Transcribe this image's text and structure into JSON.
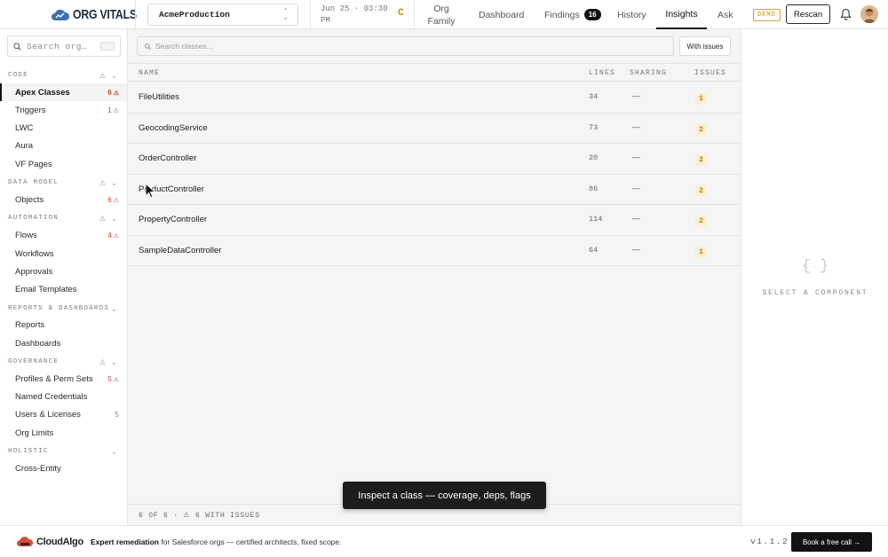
{
  "header": {
    "logo_text": "ORG VITALS",
    "org_name": "AcmeProduction",
    "scan_date_line1": "Jun 25 · 03:30",
    "scan_date_line2": "PM",
    "grade": "C",
    "nav": [
      {
        "label_line1": "Org",
        "label_line2": "Family"
      },
      {
        "label": "Dashboard"
      },
      {
        "label": "Findings",
        "badge": "16"
      },
      {
        "label": "History"
      },
      {
        "label": "Insights",
        "active": true
      },
      {
        "label": "Ask"
      }
    ],
    "demo_badge": "DEMO",
    "rescan_label": "Rescan"
  },
  "sidebar": {
    "search_placeholder": "Search org…",
    "sections": [
      {
        "title": "CODE",
        "items": [
          {
            "label": "Apex Classes",
            "count": "6",
            "warn": true,
            "active": true
          },
          {
            "label": "Triggers",
            "count": "1",
            "warn": true
          },
          {
            "label": "LWC"
          },
          {
            "label": "Aura"
          },
          {
            "label": "VF Pages"
          }
        ]
      },
      {
        "title": "DATA MODEL",
        "items": [
          {
            "label": "Objects",
            "count": "6",
            "warn": true
          }
        ]
      },
      {
        "title": "AUTOMATION",
        "items": [
          {
            "label": "Flows",
            "count": "4",
            "warn": true
          },
          {
            "label": "Workflows"
          },
          {
            "label": "Approvals"
          },
          {
            "label": "Email Templates"
          }
        ]
      },
      {
        "title": "REPORTS & DASHBOARDS",
        "items": [
          {
            "label": "Reports"
          },
          {
            "label": "Dashboards"
          }
        ]
      },
      {
        "title": "GOVERNANCE",
        "items": [
          {
            "label": "Profiles & Perm Sets",
            "count": "5",
            "warn": true
          },
          {
            "label": "Named Credentials"
          },
          {
            "label": "Users & Licenses",
            "count": "5",
            "warn": false
          },
          {
            "label": "Org Limits"
          }
        ]
      },
      {
        "title": "HOLISTIC",
        "items": [
          {
            "label": "Cross-Entity"
          }
        ]
      }
    ]
  },
  "main": {
    "search_placeholder": "Search classes...",
    "filter_label": "With issues",
    "columns": {
      "name": "NAME",
      "lines": "LINES",
      "sharing": "SHARING",
      "issues": "ISSUES"
    },
    "rows": [
      {
        "name": "FileUtilities",
        "lines": "34",
        "sharing": "—",
        "issues": "1"
      },
      {
        "name": "GeocodingService",
        "lines": "73",
        "sharing": "—",
        "issues": "2"
      },
      {
        "name": "OrderController",
        "lines": "20",
        "sharing": "—",
        "issues": "2"
      },
      {
        "name": "ProductController",
        "lines": "86",
        "sharing": "—",
        "issues": "2"
      },
      {
        "name": "PropertyController",
        "lines": "114",
        "sharing": "—",
        "issues": "2"
      },
      {
        "name": "SampleDataController",
        "lines": "64",
        "sharing": "—",
        "issues": "1"
      }
    ],
    "footer": "6 OF 6 · ⚠ 6 WITH ISSUES"
  },
  "detail": {
    "braces": "{ }",
    "empty_text": "SELECT A COMPONENT"
  },
  "toast": {
    "text": "Inspect a class — coverage, deps, flags"
  },
  "banner": {
    "brand": "CloudAlgo",
    "headline": "Expert remediation",
    "text": " for Salesforce orgs — certified architects, fixed scope.",
    "version": "v1.1.2",
    "cta": "Book a free call →"
  },
  "colors": {
    "accent_warning": "#d08a00",
    "issue_count": "#c44a2c",
    "dark": "#111111"
  }
}
